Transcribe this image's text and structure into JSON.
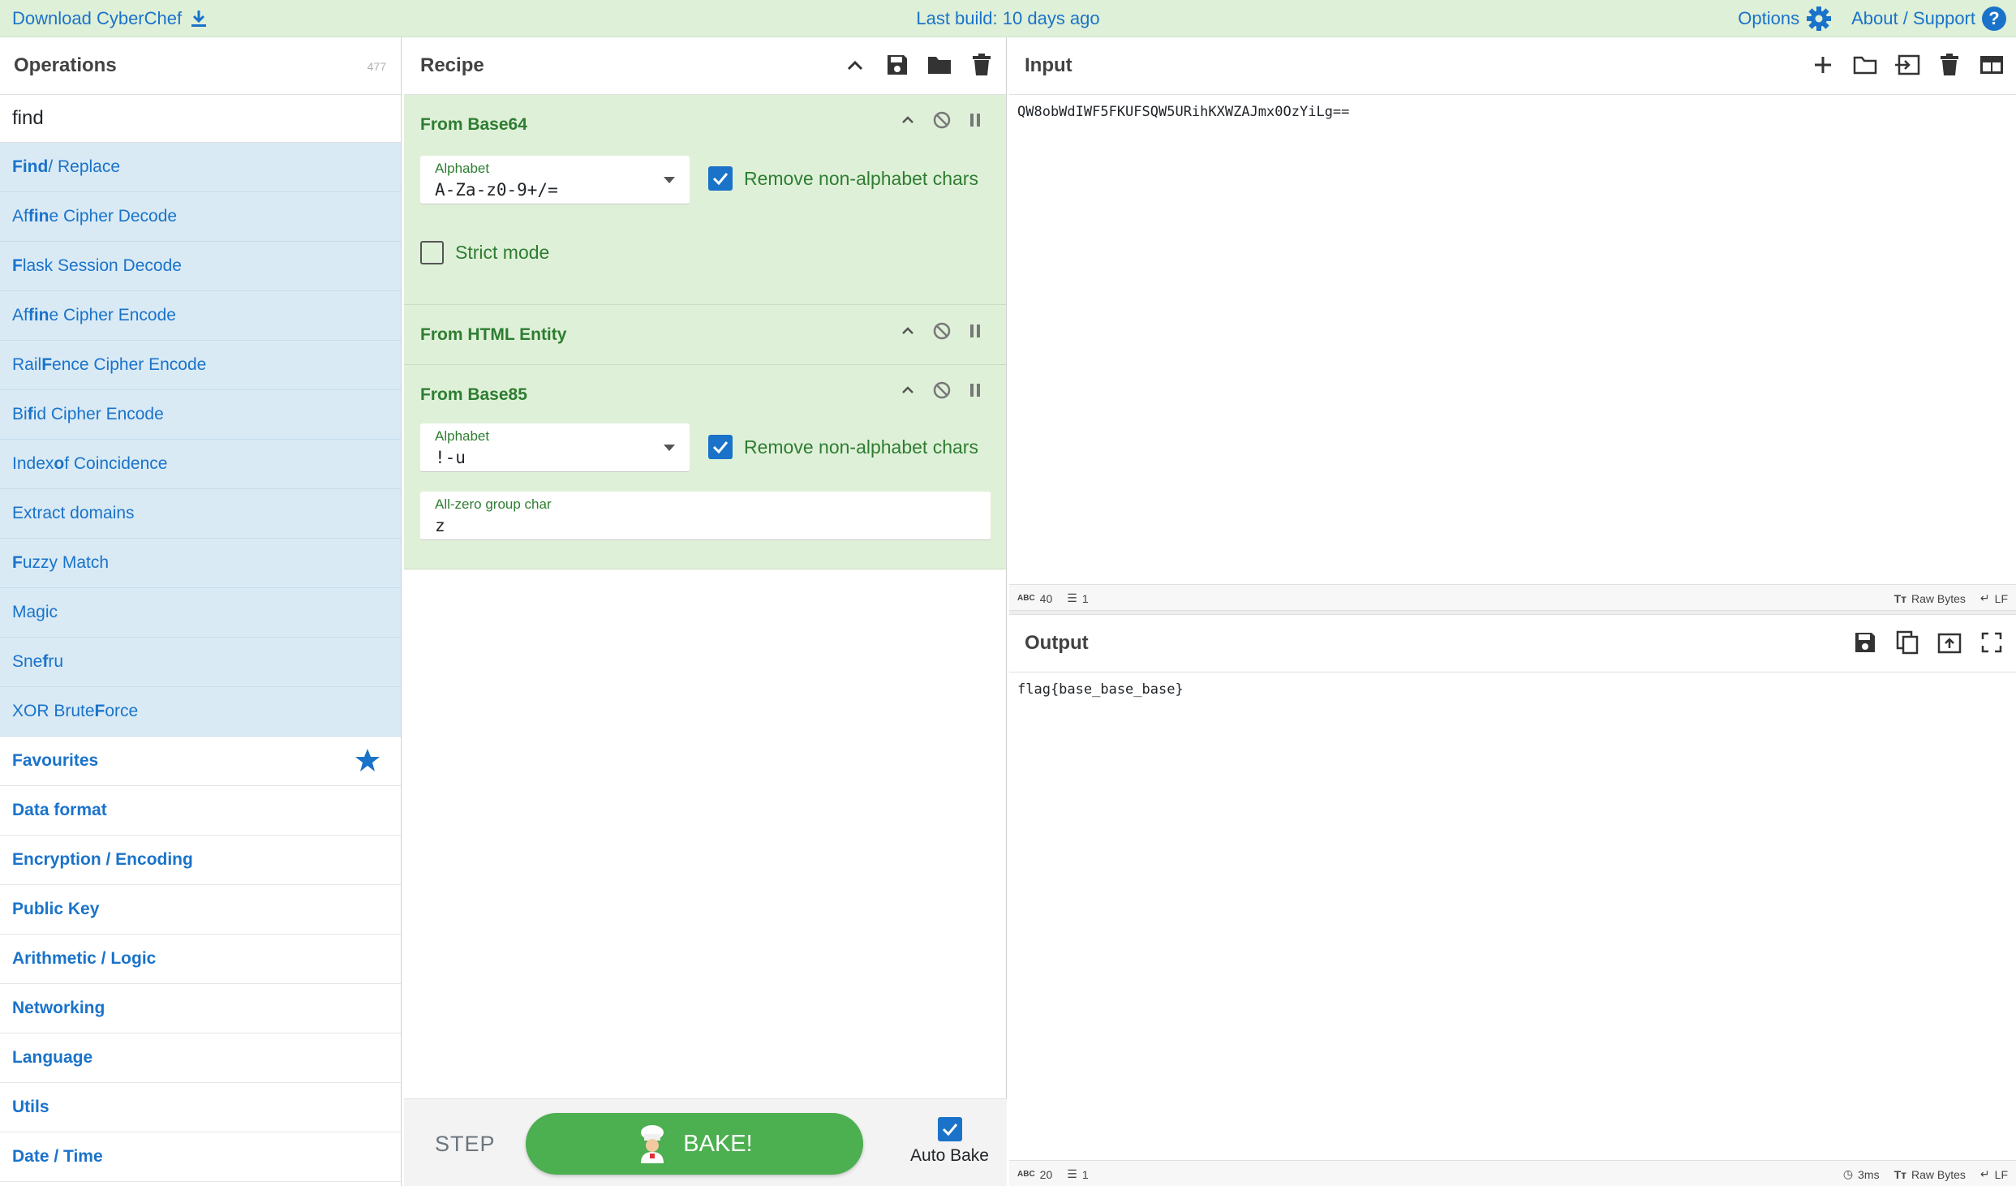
{
  "banner": {
    "download_label": "Download CyberChef",
    "last_build": "Last build: 10 days ago",
    "options_label": "Options",
    "about_label": "About / Support"
  },
  "operations": {
    "title": "Operations",
    "count": "477",
    "search_value": "find",
    "results": [
      {
        "pre": "",
        "bold": "Find",
        "post": " / Replace"
      },
      {
        "pre": "Af",
        "bold": "fin",
        "post": "e Cipher Decode"
      },
      {
        "pre": "",
        "bold": "F",
        "post": "lask Session Decode"
      },
      {
        "pre": "Af",
        "bold": "fin",
        "post": "e Cipher Encode"
      },
      {
        "pre": "Rail ",
        "bold": "F",
        "post": "ence Cipher Encode"
      },
      {
        "pre": "Bi",
        "bold": "f",
        "post": "id Cipher Encode"
      },
      {
        "pre": "Index ",
        "bold": "o",
        "post": "f Coincidence"
      },
      {
        "pre": "Extract domains",
        "bold": "",
        "post": ""
      },
      {
        "pre": "",
        "bold": "F",
        "post": "uzzy Match"
      },
      {
        "pre": "Magic",
        "bold": "",
        "post": ""
      },
      {
        "pre": "Sne",
        "bold": "f",
        "post": "ru"
      },
      {
        "pre": "XOR Brute ",
        "bold": "F",
        "post": "orce"
      }
    ],
    "categories": [
      "Favourites",
      "Data format",
      "Encryption / Encoding",
      "Public Key",
      "Arithmetic / Logic",
      "Networking",
      "Language",
      "Utils",
      "Date / Time"
    ]
  },
  "recipe": {
    "title": "Recipe",
    "ops": [
      {
        "name": "From Base64",
        "alphabet_label": "Alphabet",
        "alphabet_value": "A-Za-z0-9+/=",
        "remove_label": "Remove non-alphabet chars",
        "strict_label": "Strict mode"
      },
      {
        "name": "From HTML Entity"
      },
      {
        "name": "From Base85",
        "alphabet_label": "Alphabet",
        "alphabet_value": "!-u",
        "remove_label": "Remove non-alphabet chars",
        "zero_label": "All-zero group char",
        "zero_value": "z"
      }
    ],
    "step_label": "STEP",
    "bake_label": "BAKE!",
    "autobake_label": "Auto Bake"
  },
  "input": {
    "title": "Input",
    "text": "QW8obWdIWF5FKUFSQW5URihKXWZAJmx0OzYiLg==",
    "length": "40",
    "lines": "1",
    "encoding": "Raw Bytes",
    "eol": "LF"
  },
  "output": {
    "title": "Output",
    "text": "flag{base_base_base}",
    "length": "20",
    "lines": "1",
    "time": "3ms",
    "encoding": "Raw Bytes",
    "eol": "LF"
  },
  "colors": {
    "banner_bg": "#dff0d8",
    "link_blue": "#1a73c9",
    "op_green": "#2e7d32",
    "bake_green": "#4caf50",
    "result_bg": "#d9eaf5"
  }
}
